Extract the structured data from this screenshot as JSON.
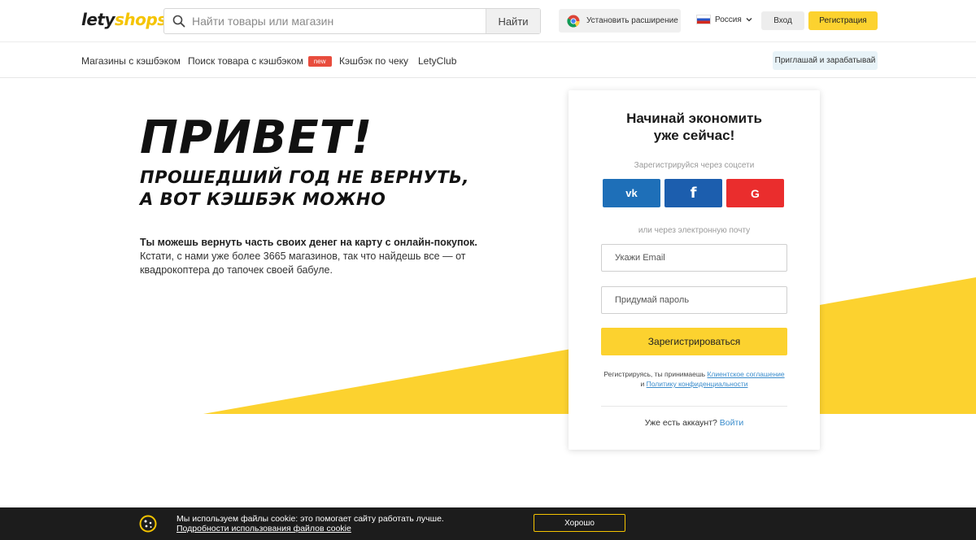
{
  "header": {
    "logo_part1": "lety",
    "logo_part2": "shops",
    "search_placeholder": "Найти товары или магазин",
    "search_button": "Найти",
    "extension_button": "Установить расширение",
    "country": "Россия",
    "login_button": "Вход",
    "register_button": "Регистрация"
  },
  "nav": {
    "items": [
      {
        "label": "Магазины с кэшбэком"
      },
      {
        "label": "Поиск товара с кэшбэком",
        "badge": "new"
      },
      {
        "label": "Кэшбэк по чеку"
      },
      {
        "label": "LetyClub"
      }
    ],
    "invite_button": "Приглашай и зарабатывай"
  },
  "hero": {
    "title": "ПРИВЕТ!",
    "subtitle_line1": "ПРОШЕДШИЙ ГОД НЕ ВЕРНУТЬ,",
    "subtitle_line2": "А ВОТ КЭШБЭК МОЖНО",
    "lead": "Ты можешь вернуть часть своих денег на карту с онлайн-покупок.",
    "text": "Кстати, с нами уже более 3665 магазинов, так что найдешь все — от квадрокоптера до тапочек своей бабуле."
  },
  "signup": {
    "title_line1": "Начинай экономить",
    "title_line2": "уже сейчас!",
    "social_label": "Зарегистрируйся через соцсети",
    "social": {
      "vk": "vk",
      "fb": "f",
      "google": "G"
    },
    "email_label": "или через электронную почту",
    "email_placeholder": "Укажи Email",
    "password_placeholder": "Придумай пароль",
    "submit": "Зарегистрироваться",
    "terms_prefix": "Регистрируясь, ты принимаешь",
    "terms_link1": "Клиентское соглашение",
    "terms_and": "и",
    "terms_link2": "Политику конфиденциальности",
    "have_account": "Уже есть аккаунт?",
    "login_link": "Войти"
  },
  "cookie": {
    "text": "Мы используем файлы cookie: это помогает сайту работать лучше.",
    "link": "Подробности использования файлов cookie",
    "button": "Хорошо"
  },
  "colors": {
    "accent_yellow": "#fcd22f",
    "vk_blue": "#1e6fb8",
    "fb_blue": "#1c5eae",
    "google_red": "#ea2d2d",
    "badge_red": "#e84c3d",
    "link_blue": "#3a8ccc"
  }
}
